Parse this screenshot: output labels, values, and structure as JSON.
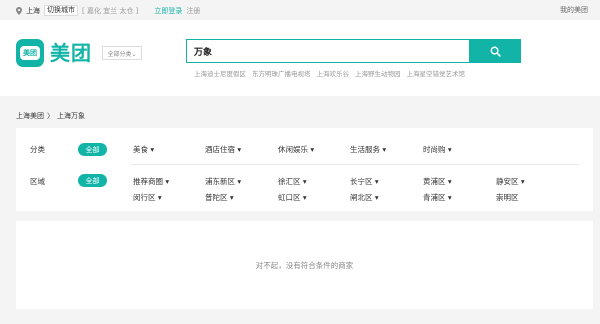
{
  "topbar": {
    "city": "上海",
    "switch_city": "切换城市",
    "nearby": "[ 嘉化  宜兰  太仓 ]",
    "login": "立即登录",
    "register": "注册",
    "my_meituan": "我的美团"
  },
  "header": {
    "logo_badge": "美团",
    "logo_text": "美团",
    "all_categories": "全部分类⌄",
    "search_value": "万象",
    "hot_searches": [
      "上海迪士尼度假区",
      "东方明珠广播电视塔",
      "上海欢乐谷",
      "上海野生动物园",
      "上海星空错觉艺术馆"
    ]
  },
  "breadcrumb": {
    "home": "上海美团",
    "separator": "〉",
    "current": "上海万象"
  },
  "filters": {
    "category": {
      "label": "分类",
      "all": "全部",
      "options": [
        "美食",
        "酒店住宿",
        "休闲娱乐",
        "生活服务",
        "时尚购"
      ]
    },
    "area": {
      "label": "区域",
      "all": "全部",
      "options_row1": [
        "推荐商圈",
        "浦东新区",
        "徐汇区",
        "长宁区",
        "黄浦区",
        "静安区"
      ],
      "options_row2": [
        "闵行区",
        "普陀区",
        "虹口区",
        "闸北区",
        "青浦区",
        "崇明区"
      ],
      "dropdown_marks_row2": [
        true,
        true,
        true,
        true,
        true,
        false
      ]
    }
  },
  "result": {
    "empty_message": "对不起，没有符合条件的商家"
  },
  "colors": {
    "brand": "#13b4a8"
  }
}
